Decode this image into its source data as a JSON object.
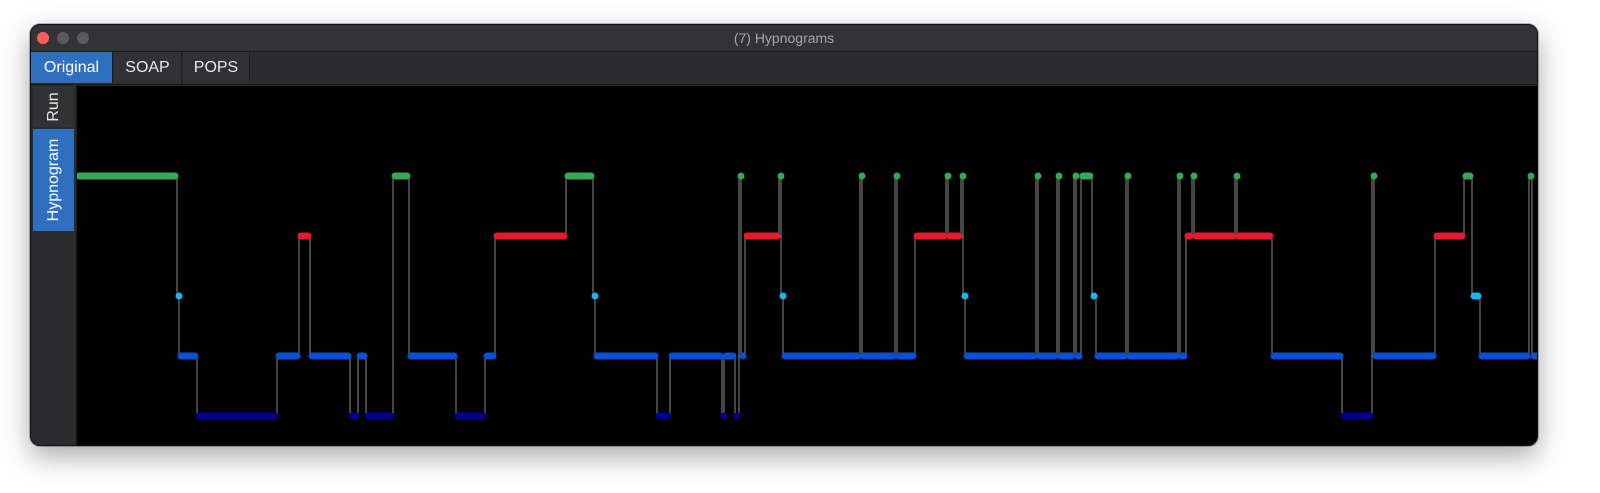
{
  "window": {
    "title": "(7) Hypnograms"
  },
  "tabs": [
    {
      "label": "Original",
      "active": true
    },
    {
      "label": "SOAP",
      "active": false
    },
    {
      "label": "POPS",
      "active": false
    }
  ],
  "side_tabs": [
    {
      "label": "Run",
      "active": false
    },
    {
      "label": "Hypnogram",
      "active": true
    }
  ],
  "colors": {
    "Wake": "#34a853",
    "REM": "#e8192c",
    "N1": "#1ab6f0",
    "N2": "#0b4fd6",
    "N3": "#00008b",
    "connector": "#8a8a8a",
    "background": "#000000",
    "accent": "#2f6fc0"
  },
  "chart_data": {
    "type": "line",
    "title": "",
    "xlabel": "",
    "ylabel": "",
    "stage_order": [
      "Wake",
      "REM",
      "N1",
      "N2",
      "N3"
    ],
    "xlim": [
      0,
      1461
    ],
    "segments": [
      {
        "stage": "Wake",
        "start": 0,
        "end": 100
      },
      {
        "stage": "N1",
        "start": 100,
        "end": 102
      },
      {
        "stage": "N2",
        "start": 102,
        "end": 120
      },
      {
        "stage": "N3",
        "start": 120,
        "end": 200
      },
      {
        "stage": "N2",
        "start": 200,
        "end": 222
      },
      {
        "stage": "REM",
        "start": 222,
        "end": 233
      },
      {
        "stage": "N2",
        "start": 233,
        "end": 273
      },
      {
        "stage": "N3",
        "start": 273,
        "end": 281
      },
      {
        "stage": "N2",
        "start": 281,
        "end": 289
      },
      {
        "stage": "N3",
        "start": 289,
        "end": 316
      },
      {
        "stage": "Wake",
        "start": 316,
        "end": 332
      },
      {
        "stage": "N2",
        "start": 332,
        "end": 379
      },
      {
        "stage": "N3",
        "start": 379,
        "end": 408
      },
      {
        "stage": "N2",
        "start": 408,
        "end": 418
      },
      {
        "stage": "REM",
        "start": 418,
        "end": 489
      },
      {
        "stage": "Wake",
        "start": 489,
        "end": 516
      },
      {
        "stage": "N1",
        "start": 516,
        "end": 518
      },
      {
        "stage": "N2",
        "start": 518,
        "end": 580
      },
      {
        "stage": "N3",
        "start": 580,
        "end": 593
      },
      {
        "stage": "N2",
        "start": 593,
        "end": 645
      },
      {
        "stage": "N3",
        "start": 645,
        "end": 647
      },
      {
        "stage": "N2",
        "start": 647,
        "end": 658
      },
      {
        "stage": "N3",
        "start": 658,
        "end": 662
      },
      {
        "stage": "Wake",
        "start": 662,
        "end": 664
      },
      {
        "stage": "N2",
        "start": 664,
        "end": 668
      },
      {
        "stage": "REM",
        "start": 668,
        "end": 702
      },
      {
        "stage": "Wake",
        "start": 702,
        "end": 704
      },
      {
        "stage": "N1",
        "start": 704,
        "end": 706
      },
      {
        "stage": "N2",
        "start": 706,
        "end": 783
      },
      {
        "stage": "Wake",
        "start": 783,
        "end": 785
      },
      {
        "stage": "N2",
        "start": 785,
        "end": 818
      },
      {
        "stage": "Wake",
        "start": 818,
        "end": 820
      },
      {
        "stage": "N2",
        "start": 820,
        "end": 838
      },
      {
        "stage": "REM",
        "start": 838,
        "end": 869
      },
      {
        "stage": "Wake",
        "start": 869,
        "end": 871
      },
      {
        "stage": "REM",
        "start": 871,
        "end": 884
      },
      {
        "stage": "Wake",
        "start": 884,
        "end": 886
      },
      {
        "stage": "N1",
        "start": 886,
        "end": 888
      },
      {
        "stage": "N2",
        "start": 888,
        "end": 959
      },
      {
        "stage": "Wake",
        "start": 959,
        "end": 961
      },
      {
        "stage": "N2",
        "start": 961,
        "end": 980
      },
      {
        "stage": "Wake",
        "start": 980,
        "end": 982
      },
      {
        "stage": "N2",
        "start": 982,
        "end": 997
      },
      {
        "stage": "Wake",
        "start": 997,
        "end": 999
      },
      {
        "stage": "N2",
        "start": 999,
        "end": 1004
      },
      {
        "stage": "Wake",
        "start": 1004,
        "end": 1015
      },
      {
        "stage": "N1",
        "start": 1015,
        "end": 1019
      },
      {
        "stage": "N2",
        "start": 1019,
        "end": 1049
      },
      {
        "stage": "Wake",
        "start": 1049,
        "end": 1051
      },
      {
        "stage": "N2",
        "start": 1051,
        "end": 1101
      },
      {
        "stage": "Wake",
        "start": 1101,
        "end": 1103
      },
      {
        "stage": "N2",
        "start": 1103,
        "end": 1109
      },
      {
        "stage": "REM",
        "start": 1109,
        "end": 1115
      },
      {
        "stage": "Wake",
        "start": 1115,
        "end": 1117
      },
      {
        "stage": "REM",
        "start": 1117,
        "end": 1158
      },
      {
        "stage": "Wake",
        "start": 1158,
        "end": 1160
      },
      {
        "stage": "REM",
        "start": 1160,
        "end": 1195
      },
      {
        "stage": "N2",
        "start": 1195,
        "end": 1265
      },
      {
        "stage": "N3",
        "start": 1265,
        "end": 1295
      },
      {
        "stage": "Wake",
        "start": 1295,
        "end": 1297
      },
      {
        "stage": "N2",
        "start": 1297,
        "end": 1358
      },
      {
        "stage": "REM",
        "start": 1358,
        "end": 1387
      },
      {
        "stage": "Wake",
        "start": 1387,
        "end": 1395
      },
      {
        "stage": "N1",
        "start": 1395,
        "end": 1403
      },
      {
        "stage": "N2",
        "start": 1403,
        "end": 1452
      },
      {
        "stage": "Wake",
        "start": 1452,
        "end": 1455
      },
      {
        "stage": "N2",
        "start": 1455,
        "end": 1461
      }
    ]
  }
}
